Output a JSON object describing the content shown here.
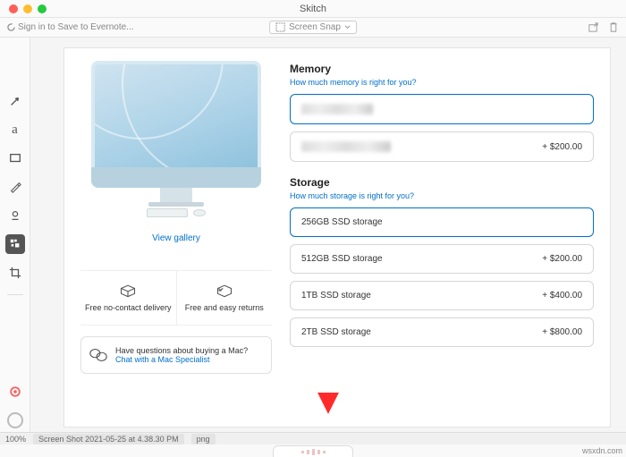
{
  "window": {
    "title": "Skitch"
  },
  "toolbar": {
    "signin": "Sign in to Save to Evernote...",
    "capture_label": "Screen Snap"
  },
  "product": {
    "gallery_link": "View gallery",
    "delivery_label": "Free no-contact delivery",
    "returns_label": "Free and easy returns",
    "help_question": "Have questions about buying a Mac?",
    "help_link": "Chat with a Mac Specialist"
  },
  "memory": {
    "title": "Memory",
    "link": "How much memory is right for you?",
    "options": [
      {
        "label": "",
        "price": ""
      },
      {
        "label": "",
        "price": "+ $200.00"
      }
    ]
  },
  "storage": {
    "title": "Storage",
    "link": "How much storage is right for you?",
    "options": [
      {
        "label": "256GB SSD storage",
        "price": ""
      },
      {
        "label": "512GB SSD storage",
        "price": "+ $200.00"
      },
      {
        "label": "1TB SSD storage",
        "price": "+ $400.00"
      },
      {
        "label": "2TB SSD storage",
        "price": "+ $800.00"
      }
    ]
  },
  "status": {
    "zoom": "100%",
    "filename": "Screen Shot 2021-05-25 at 4.38.30 PM",
    "ext": "png"
  },
  "watermark": "wsxdn.com"
}
